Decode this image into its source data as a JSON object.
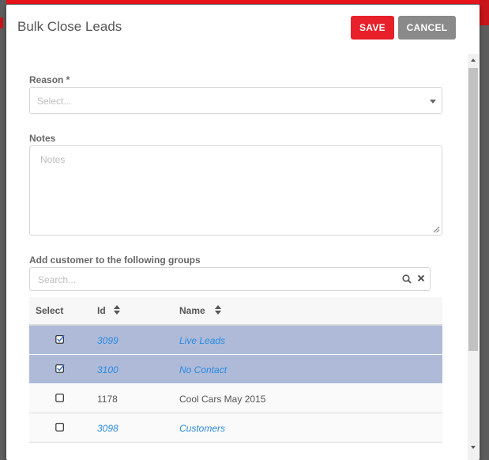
{
  "dialog": {
    "title": "Bulk Close Leads",
    "save_label": "SAVE",
    "cancel_label": "CANCEL"
  },
  "reason": {
    "label": "Reason *",
    "placeholder": "Select..."
  },
  "notes": {
    "label": "Notes",
    "placeholder": "Notes"
  },
  "groups": {
    "label": "Add customer to the following groups",
    "search_placeholder": "Search...",
    "columns": {
      "select": "Select",
      "id": "Id",
      "name": "Name"
    },
    "rows": [
      {
        "id": "3099",
        "name": "Live Leads",
        "checked": true,
        "link": true
      },
      {
        "id": "3100",
        "name": "No Contact",
        "checked": true,
        "link": true
      },
      {
        "id": "1178",
        "name": "Cool Cars May 2015",
        "checked": false,
        "link": false
      },
      {
        "id": "3098",
        "name": "Customers",
        "checked": false,
        "link": true
      }
    ]
  },
  "colors": {
    "accent": "#e8202a",
    "cancel": "#8a8a8a",
    "selected_row": "#aebad8",
    "link": "#2a8ae0"
  }
}
